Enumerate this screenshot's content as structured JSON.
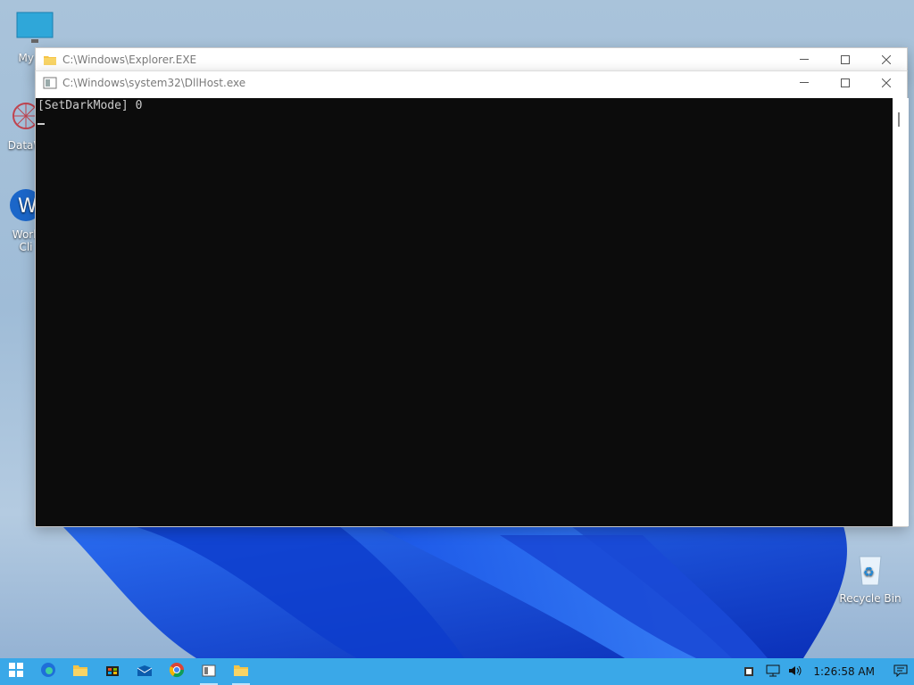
{
  "desktop": {
    "icons": [
      {
        "label": "My Co",
        "name": "my-computer"
      },
      {
        "label": "DataW",
        "name": "datawarrior"
      },
      {
        "label": "Work",
        "label2": "Cli",
        "name": "workspace-client"
      },
      {
        "label": "Recycle Bin",
        "name": "recycle-bin"
      }
    ]
  },
  "windows": {
    "explorer": {
      "title": "C:\\Windows\\Explorer.EXE"
    },
    "dllhost": {
      "title": "C:\\Windows\\system32\\DllHost.exe"
    }
  },
  "console": {
    "output_line": "[SetDarkMode] 0"
  },
  "taskbar": {
    "apps": [
      "start-icon",
      "edge-icon",
      "file-explorer-icon",
      "store-icon",
      "mail-icon",
      "chrome-icon",
      "app-window-icon",
      "folder-icon"
    ],
    "clock": "1:26:58 AM"
  },
  "colors": {
    "taskbar": "#3aa8e8",
    "console_bg": "#0c0c0c",
    "console_fg": "#cccccc"
  }
}
